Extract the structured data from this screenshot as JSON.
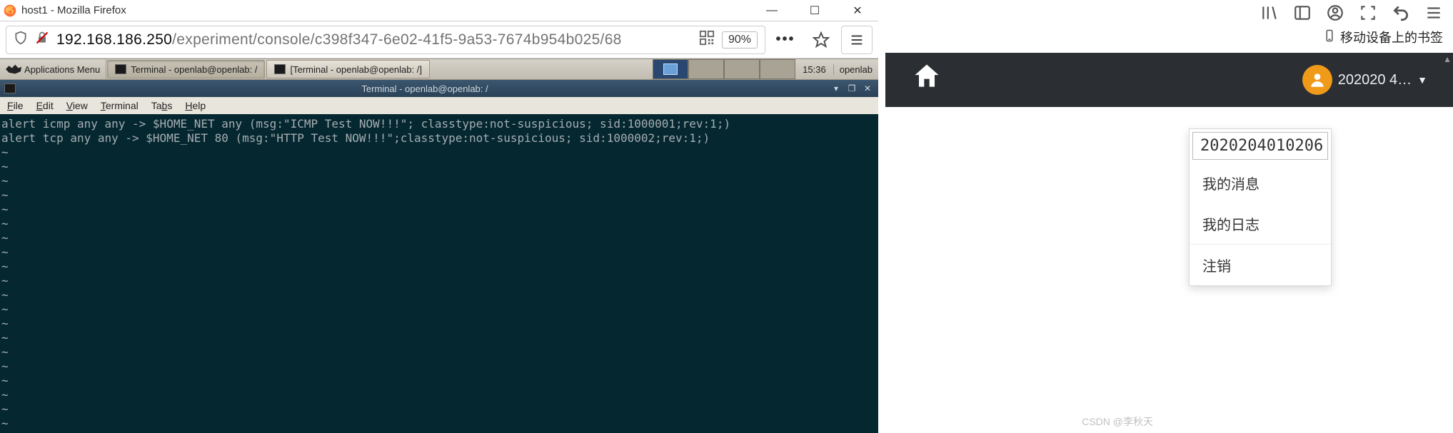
{
  "window": {
    "title": "host1 - Mozilla Firefox"
  },
  "urlbar": {
    "host": "192.168.186.250",
    "path": "/experiment/console/c398f347-6e02-41f5-9a53-7674b954b025/68",
    "zoom": "90%"
  },
  "xfce": {
    "apps_label": "Applications Menu",
    "task1": "Terminal - openlab@openlab: /",
    "task2": "[Terminal - openlab@openlab: /]",
    "clock": "15:36",
    "user": "openlab"
  },
  "terminal": {
    "title": "Terminal - openlab@openlab: /",
    "menu": {
      "file": "File",
      "edit": "Edit",
      "view": "View",
      "terminal": "Terminal",
      "tabs": "Tabs",
      "help": "Help"
    },
    "lines": [
      "alert icmp any any -> $HOME_NET any (msg:\"ICMP Test NOW!!!\"; classtype:not-suspicious; sid:1000001;rev:1;)",
      "alert tcp any any -> $HOME_NET 80 (msg:\"HTTP Test NOW!!!\";classtype:not-suspicious; sid:1000002;rev:1;)",
      "~",
      "~",
      "~",
      "~",
      "~",
      "~",
      "~",
      "~",
      "~",
      "~",
      "~",
      "~",
      "~",
      "~",
      "~",
      "~",
      "~",
      "~",
      "~",
      "~",
      "~",
      "~"
    ]
  },
  "right": {
    "bookmark_label": "移动设备上的书签",
    "user_short": "202020 4…",
    "dropdown": {
      "account_id": "2020204010206",
      "my_messages": "我的消息",
      "my_logs": "我的日志",
      "logout": "注销"
    }
  },
  "watermark": "CSDN @李秋天"
}
